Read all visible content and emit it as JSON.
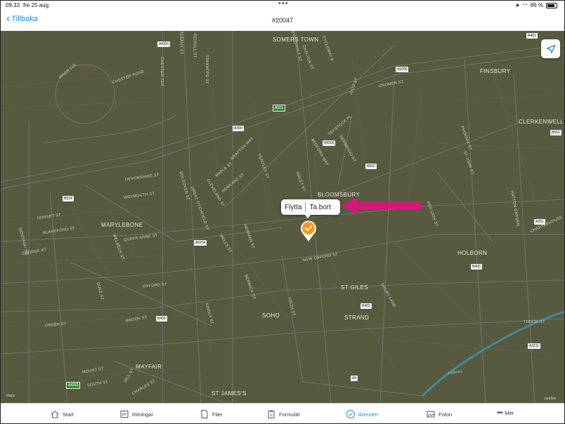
{
  "status": {
    "time": "09:33",
    "date": "fre 25 aug.",
    "battery": "86 %"
  },
  "nav": {
    "back_label": "Tillbaka",
    "title": "#20047"
  },
  "map": {
    "areas": [
      "SOMERS TOWN",
      "FINSBURY",
      "CLERKENWELL",
      "BLOOMSBURY",
      "MARYLEBONE",
      "HOLBORN",
      "ST GILES",
      "STRAND",
      "SOHO",
      "MAYFAIR",
      "ST JAMES'S"
    ],
    "streets": [
      "INNER CIR",
      "CHESTER ROAD",
      "CHESTER TER",
      "ALBANY ST",
      "REDHILL ST",
      "STANHOPE ST",
      "EVERSHOLT ST",
      "CHALTON ST",
      "CYCLEWAY 6",
      "JUDD ST",
      "CROMER ST",
      "TAVISTOCK PL",
      "GRAFTON WAY",
      "HUNTLEY ST",
      "BEDFORD WAY",
      "MALET ST",
      "HERBRAND ST",
      "DEVONSHIRE ST",
      "WEYMOUTH ST",
      "BOLSOVER ST",
      "MAPLE ST",
      "HOWLAND ST",
      "CLEVELAND ST",
      "GREAT TITCHFIELD ST",
      "DORSET ST",
      "BLANDFORD ST",
      "MONTAGU SQ",
      "GEORGE ST",
      "WELBECK ST",
      "QUEEN ANNE ST",
      "WELLS ST",
      "NEWMAN ST",
      "NEW OXFORD ST",
      "OXFORD ST",
      "DUKE ST",
      "BROOK ST",
      "KINGLY ST",
      "BERWICK ST",
      "FRITH ST",
      "DRURY LANE",
      "GREEN ST",
      "MOUNT ST",
      "SOUTH ST",
      "HILL ST",
      "CHARLES ST",
      "RED LION ST",
      "HATTON GARDEN",
      "CHARTERHOUSE",
      "PHOENIX ST",
      "ST JOHN ST",
      "TUDOR ST"
    ],
    "shields": [
      "A401",
      "A5200",
      "A4201",
      "A501",
      "A400",
      "A4200",
      "B502",
      "B524",
      "A5204",
      "B501",
      "A201",
      "B400",
      "B402",
      "B406",
      "A3211",
      "A4202",
      "A4"
    ],
    "river": "Thames",
    "legal_left": "Maps",
    "legal_right": "Juridisk"
  },
  "popup": {
    "move_label": "Flytta",
    "delete_label": "Ta bort"
  },
  "colors": {
    "accent": "#1a8fd8",
    "pin": "#f39a1e",
    "arrow": "#d6177a",
    "map_bg": "#575a3e"
  },
  "tabs": [
    {
      "label": "Start",
      "icon": "home-icon"
    },
    {
      "label": "Ritningar",
      "icon": "drawings-icon"
    },
    {
      "label": "Filer",
      "icon": "file-icon"
    },
    {
      "label": "Formulär",
      "icon": "clipboard-icon"
    },
    {
      "label": "Ärenden",
      "icon": "check-circle-icon",
      "active": true
    },
    {
      "label": "Foton",
      "icon": "photo-icon"
    },
    {
      "label": "Mer",
      "icon": "more-icon"
    }
  ]
}
